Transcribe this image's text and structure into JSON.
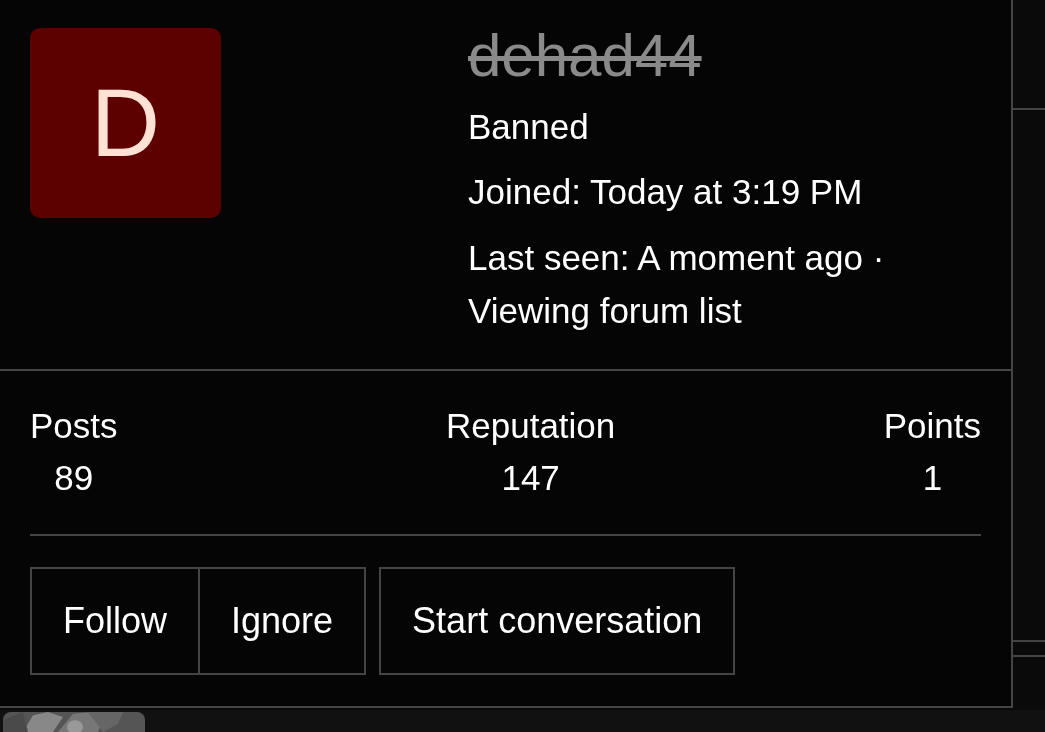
{
  "profile": {
    "avatar_initial": "D",
    "username": "dehad44",
    "username_struck": true,
    "user_title": "Banned",
    "joined": "Joined: Today at 3:19 PM",
    "last_seen": "Last seen: A moment ago · Viewing forum list"
  },
  "stats": [
    {
      "label": "Posts",
      "value": "89"
    },
    {
      "label": "Reputation",
      "value": "147"
    },
    {
      "label": "Points",
      "value": "1"
    }
  ],
  "button_groups": [
    [
      {
        "label": "Follow"
      },
      {
        "label": "Ignore"
      }
    ],
    [
      {
        "label": "Start conversation"
      }
    ]
  ],
  "below": {
    "kind": "picture"
  }
}
